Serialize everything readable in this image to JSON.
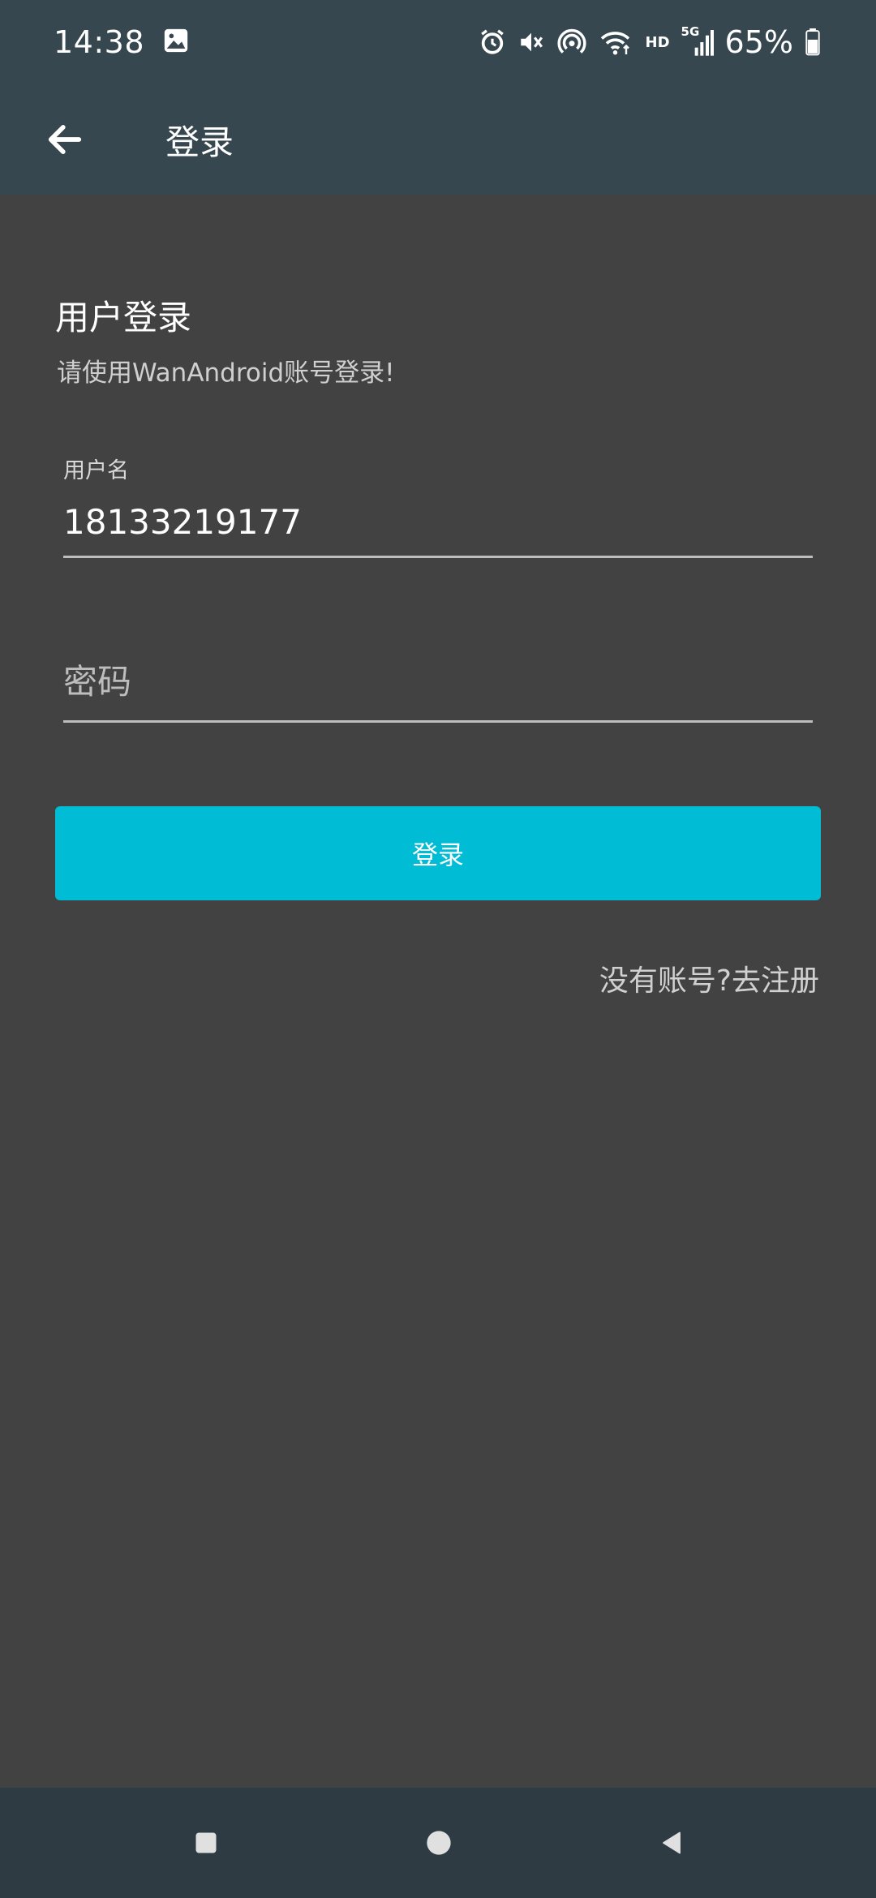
{
  "status_bar": {
    "time": "14:38",
    "network_label": "HD",
    "signal_label": "5G",
    "battery_percent": "65%",
    "icons": [
      "image-icon",
      "alarm-icon",
      "mute-icon",
      "hotspot-icon",
      "wifi-icon",
      "signal-icon",
      "battery-icon"
    ]
  },
  "app_bar": {
    "title": "登录",
    "back_icon": "arrow-left-icon"
  },
  "login": {
    "title": "用户登录",
    "subtitle": "请使用WanAndroid账号登录!",
    "username_label": "用户名",
    "username_value": "18133219177",
    "password_placeholder": "密码",
    "password_value": "",
    "button_label": "登录",
    "register_link": "没有账号?去注册"
  },
  "nav_bar": {
    "icons": [
      "recents-square-icon",
      "home-circle-icon",
      "back-triangle-icon"
    ]
  },
  "colors": {
    "background": "#424242",
    "app_bar": "#37474f",
    "accent": "#00bcd4",
    "nav_bar": "#2e3b43"
  }
}
